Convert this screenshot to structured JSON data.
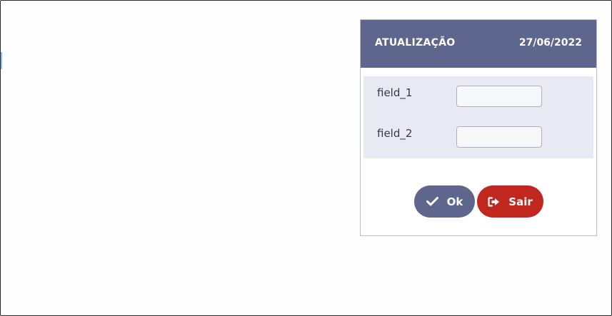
{
  "dialog": {
    "title": "ATUALIZAÇÃO",
    "date": "27/06/2022"
  },
  "fields": [
    {
      "label": "field_1",
      "value": "",
      "placeholder": ""
    },
    {
      "label": "field_2",
      "value": "",
      "placeholder": ""
    }
  ],
  "buttons": {
    "ok": {
      "label": "Ok",
      "icon": "check-icon",
      "color": "#5f668d"
    },
    "sair": {
      "label": "Sair",
      "icon": "sign-out-icon",
      "color": "#c0271f"
    }
  },
  "colors": {
    "header_bg": "#5f668d",
    "fields_bg": "#e9e9f4"
  }
}
